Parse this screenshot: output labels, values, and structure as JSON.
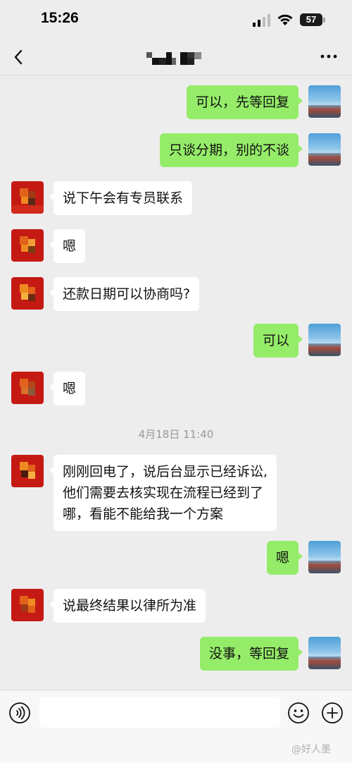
{
  "status_bar": {
    "time": "15:26",
    "battery": "57"
  },
  "header": {
    "back_icon": "chevron-left-icon",
    "title_redacted": true,
    "more_icon": "ellipsis-icon"
  },
  "messages": [
    {
      "side": "self",
      "text": "可以，先等回复"
    },
    {
      "side": "self",
      "text": "只谈分期，别的不谈"
    },
    {
      "side": "other",
      "text": "说下午会有专员联系"
    },
    {
      "side": "other",
      "text": "嗯"
    },
    {
      "side": "other",
      "text": "还款日期可以协商吗?"
    },
    {
      "side": "self",
      "text": "可以"
    },
    {
      "side": "other",
      "text": "嗯"
    },
    {
      "side": "time",
      "text": "4月18日 11:40"
    },
    {
      "side": "other",
      "lines": [
        "刚刚回电了，说后台显示已经诉讼,",
        "他们需要去核实现在流程已经到了",
        "哪，看能不能给我一个方案"
      ]
    },
    {
      "side": "self",
      "text": "嗯"
    },
    {
      "side": "other",
      "text": "说最终结果以律所为准"
    },
    {
      "side": "self",
      "text": "没事，等回复"
    }
  ],
  "input_bar": {
    "voice_icon": "voice-icon",
    "emoji_icon": "emoji-icon",
    "plus_icon": "plus-icon"
  },
  "watermark": "@好人墨",
  "colors": {
    "background": "#ededed",
    "self_bubble": "#95ec69",
    "other_bubble": "#ffffff",
    "timestamp": "#9a9a9a"
  }
}
